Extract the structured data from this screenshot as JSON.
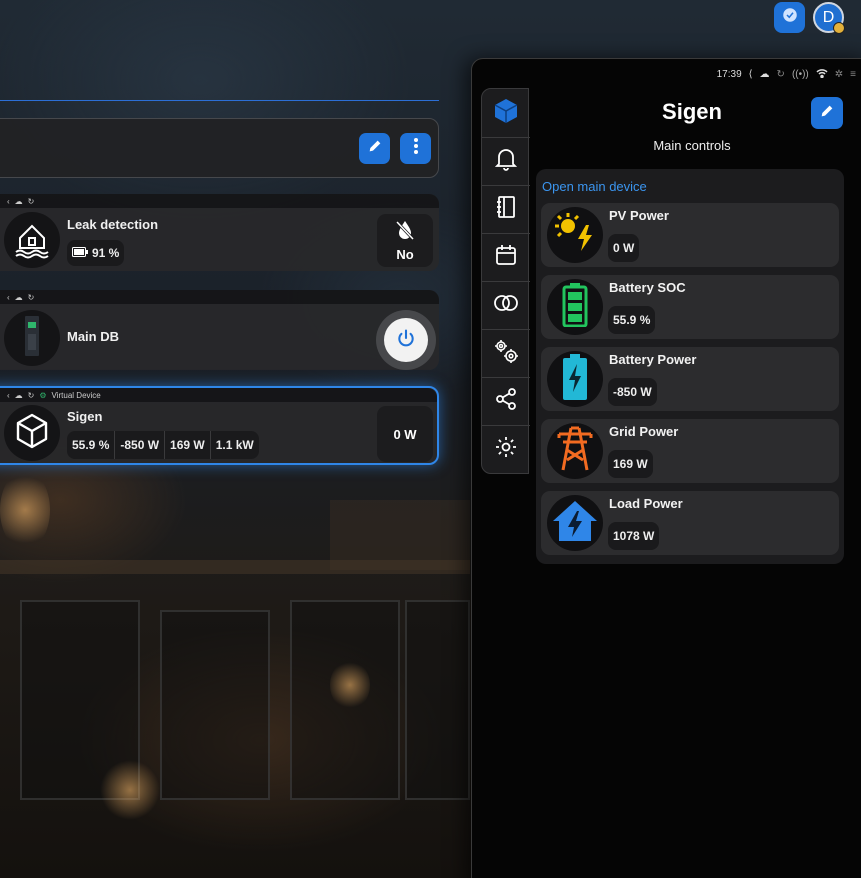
{
  "top_bar": {
    "extension_icon": "puzzle-icon",
    "avatar_letter": "D"
  },
  "header": {
    "edit_icon": "pencil-icon",
    "more_icon": "vertical-dots-icon"
  },
  "devices": [
    {
      "name": "Leak detection",
      "icon": "house-water-icon",
      "battery": "91 %",
      "side_value": "No",
      "side_icon": "water-off-icon"
    },
    {
      "name": "Main DB",
      "icon": "db-panel-icon",
      "side_icon": "power-icon"
    },
    {
      "name": "Sigen",
      "tag": "Virtual Device",
      "icon": "cube-icon",
      "stats": [
        "55.9 %",
        "-850 W",
        "169 W",
        "1.1 kW"
      ],
      "side_value": "0 W"
    }
  ],
  "panel": {
    "time": "17:39",
    "title": "Sigen",
    "subtitle": "Main controls",
    "open_main": "Open main device",
    "rail": [
      "cube-icon",
      "bell-icon",
      "notebook-icon",
      "calendar-icon",
      "link-icon",
      "gears-icon",
      "share-icon",
      "settings-icon"
    ],
    "controls": [
      {
        "name": "PV Power",
        "value": "0 W",
        "icon": "sun-bolt-icon",
        "color": "#f2c200"
      },
      {
        "name": "Battery SOC",
        "value": "55.9 %",
        "icon": "battery-full-icon",
        "color": "#22c55e"
      },
      {
        "name": "Battery Power",
        "value": "-850 W",
        "icon": "battery-charging-icon",
        "color": "#22b8d6"
      },
      {
        "name": "Grid Power",
        "value": "169 W",
        "icon": "transmission-tower-icon",
        "color": "#f26b21"
      },
      {
        "name": "Load Power",
        "value": "1078 W",
        "icon": "home-bolt-icon",
        "color": "#2f86e8"
      }
    ]
  },
  "colors": {
    "accent": "#1f72d8",
    "link": "#3b95ef",
    "sigen_border": "#2f86e8"
  }
}
